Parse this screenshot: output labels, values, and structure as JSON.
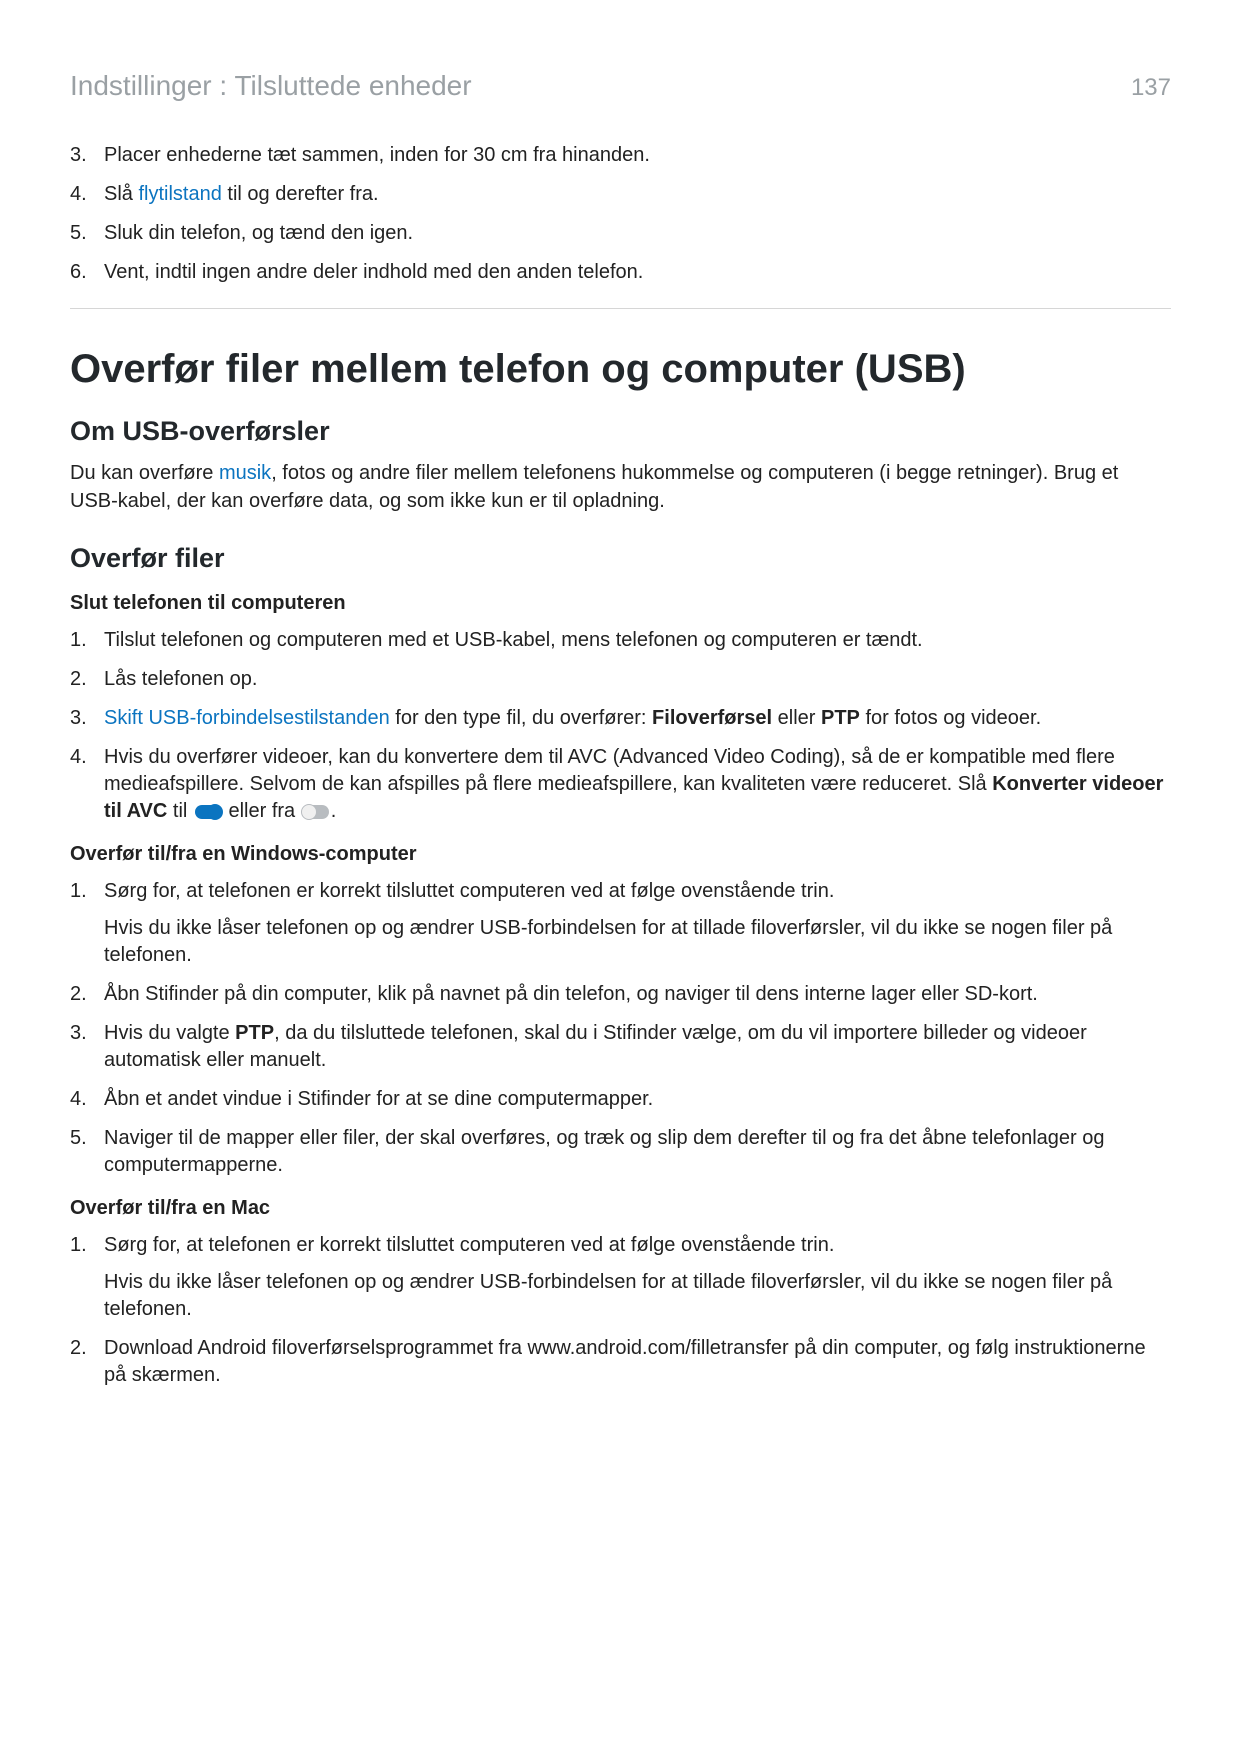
{
  "header": {
    "breadcrumb": "Indstillinger : Tilsluttede enheder",
    "page_number": "137"
  },
  "intro_list": [
    {
      "num": "3.",
      "text": "Placer enhederne tæt sammen, inden for 30 cm fra hinanden."
    },
    {
      "num": "4.",
      "pre": "Slå ",
      "link": "flytilstand",
      "post": " til og derefter fra."
    },
    {
      "num": "5.",
      "text": "Sluk din telefon, og tænd den igen."
    },
    {
      "num": "6.",
      "text": "Vent, indtil ingen andre deler indhold med den anden telefon."
    }
  ],
  "section_heading": "Overfør filer mellem telefon og computer (USB)",
  "about": {
    "heading": "Om USB-overførsler",
    "para_pre": "Du kan overføre ",
    "para_link": "musik",
    "para_post": ", fotos og andre filer mellem telefonens hukommelse og computeren (i begge retninger). Brug et USB-kabel, der kan overføre data, og som ikke kun er til opladning."
  },
  "transfer": {
    "heading": "Overfør filer",
    "connect_heading": "Slut telefonen til computeren",
    "connect_list": [
      {
        "num": "1.",
        "text": "Tilslut telefonen og computeren med et USB-kabel, mens telefonen og computeren er tændt."
      },
      {
        "num": "2.",
        "text": "Lås telefonen op."
      },
      {
        "num": "3.",
        "link": "Skift USB-forbindelsestilstanden",
        "post1": " for den type fil, du overfører: ",
        "bold1": "Filoverførsel",
        "mid": " eller ",
        "bold2": "PTP",
        "post2": " for fotos og videoer."
      },
      {
        "num": "4.",
        "pre": "Hvis du overfører videoer, kan du konvertere dem til AVC (Advanced Video Coding), så de er kompatible med flere medieafspillere. Selvom de kan afspilles på flere medieafspillere, kan kvaliteten være reduceret. Slå ",
        "bold": "Konverter videoer til AVC",
        "mid": " til ",
        "toggle_on": true,
        "mid2": " eller fra ",
        "toggle_off": true,
        "end": "."
      }
    ],
    "windows_heading": "Overfør til/fra en Windows-computer",
    "windows_list": [
      {
        "num": "1.",
        "text": "Sørg for, at telefonen er korrekt tilsluttet computeren ved at følge ovenstående trin.",
        "note": "Hvis du ikke låser telefonen op og ændrer USB-forbindelsen for at tillade filoverførsler, vil du ikke se nogen filer på telefonen."
      },
      {
        "num": "2.",
        "text": "Åbn Stifinder på din computer, klik på navnet på din telefon, og naviger til dens interne lager eller SD-kort."
      },
      {
        "num": "3.",
        "pre": "Hvis du valgte ",
        "bold": "PTP",
        "post": ", da du tilsluttede telefonen, skal du i Stifinder vælge, om du vil importere billeder og videoer automatisk eller manuelt."
      },
      {
        "num": "4.",
        "text": "Åbn et andet vindue i Stifinder for at se dine computermapper."
      },
      {
        "num": "5.",
        "text": "Naviger til de mapper eller filer, der skal overføres, og træk og slip dem derefter til og fra det åbne telefonlager og computermapperne."
      }
    ],
    "mac_heading": "Overfør til/fra en Mac",
    "mac_list": [
      {
        "num": "1.",
        "text": "Sørg for, at telefonen er korrekt tilsluttet computeren ved at følge ovenstående trin.",
        "note": "Hvis du ikke låser telefonen op og ændrer USB-forbindelsen for at tillade filoverførsler, vil du ikke se nogen filer på telefonen."
      },
      {
        "num": "2.",
        "text": "Download Android filoverførselsprogrammet fra www.android.com/filletransfer på din computer, og følg instruktionerne på skærmen."
      }
    ]
  }
}
